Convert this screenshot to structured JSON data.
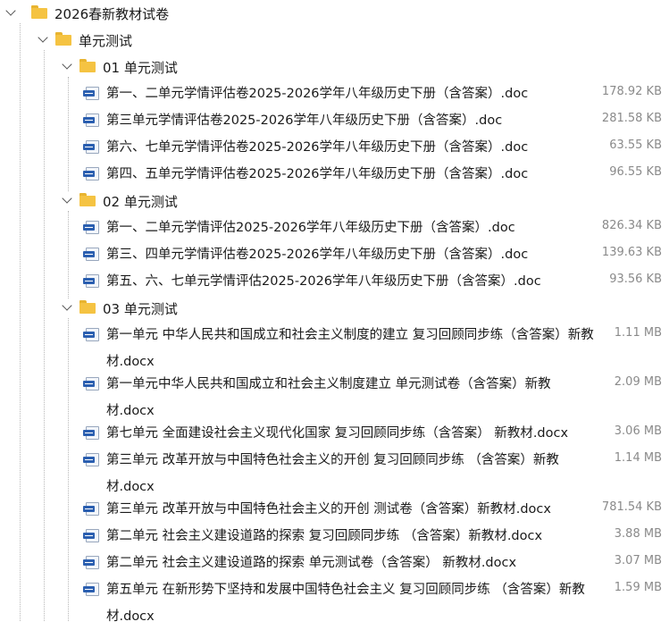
{
  "tree": {
    "root": {
      "label": "2026春新教材试卷",
      "child": {
        "label": "单元测试",
        "groups": [
          {
            "label": "01 单元测试",
            "files": [
              {
                "name": "第一、二单元学情评估卷2025-2026学年八年级历史下册（含答案）.doc",
                "size": "178.92 KB"
              },
              {
                "name": "第三单元学情评估卷2025-2026学年八年级历史下册（含答案）.doc",
                "size": "281.58 KB"
              },
              {
                "name": "第六、七单元学情评估卷2025-2026学年八年级历史下册（含答案）.doc",
                "size": "63.55 KB"
              },
              {
                "name": "第四、五单元学情评估卷2025-2026学年八年级历史下册（含答案）.doc",
                "size": "96.55 KB"
              }
            ]
          },
          {
            "label": "02 单元测试",
            "files": [
              {
                "name": "第一、二单元学情评估2025-2026学年八年级历史下册（含答案）.doc",
                "size": "826.34 KB"
              },
              {
                "name": "第三、四单元学情评估卷2025-2026学年八年级历史下册（含答案）.doc",
                "size": "139.63 KB"
              },
              {
                "name": "第五、六、七单元学情评估2025-2026学年八年级历史下册（含答案）.doc",
                "size": "93.56 KB"
              }
            ]
          },
          {
            "label": "03 单元测试",
            "files": [
              {
                "name": "第一单元 中华人民共和国成立和社会主义制度的建立 复习回顾同步练（含答案）新教材.docx",
                "size": "1.11 MB"
              },
              {
                "name": "第一单元中华人民共和国成立和社会主义制度建立 单元测试卷（含答案）新教材.docx",
                "size": "2.09 MB"
              },
              {
                "name": "第七单元 全面建设社会主义现代化国家 复习回顾同步练（含答案） 新教材.docx",
                "size": "3.06 MB"
              },
              {
                "name": "第三单元 改革开放与中国特色社会主义的开创 复习回顾同步练 （含答案）新教材.docx",
                "size": "1.14 MB"
              },
              {
                "name": "第三单元 改革开放与中国特色社会主义的开创 测试卷（含答案）新教材.docx",
                "size": "781.54 KB"
              },
              {
                "name": "第二单元 社会主义建设道路的探索 复习回顾同步练 （含答案）新教材.docx",
                "size": "3.88 MB"
              },
              {
                "name": "第二单元 社会主义建设道路的探索 单元测试卷（含答案） 新教材.docx",
                "size": "3.07 MB"
              },
              {
                "name": "第五单元 在新形势下坚持和发展中国特色社会主义 复习回顾同步练 （含答案）新教材.docx",
                "size": "1.59 MB"
              }
            ]
          }
        ]
      }
    }
  },
  "colors": {
    "folder": "#f5c342",
    "doc_icon": "#2b5fb0",
    "size_text": "#8a8a8a"
  },
  "icons": {
    "folder": "folder-icon",
    "file": "word-doc-icon",
    "expander": "chevron-down-icon"
  }
}
